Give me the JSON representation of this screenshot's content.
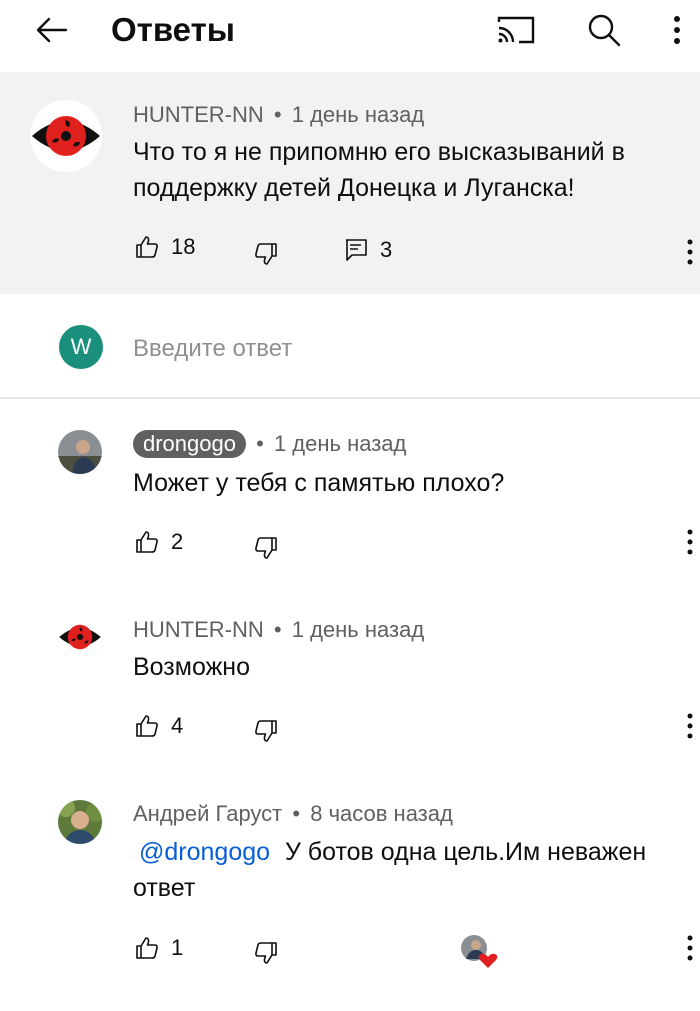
{
  "header": {
    "title": "Ответы",
    "icons": [
      "back-arrow-icon",
      "cast-icon",
      "search-icon",
      "more-vert-icon"
    ]
  },
  "parent_comment": {
    "author": "HUNTER-NN",
    "separator": "•",
    "time": "1 день назад",
    "text": "Что то я не припомню его высказываний в поддержку детей Донецка и Луганска!",
    "likes": "18",
    "replies": "3"
  },
  "reply_box": {
    "avatar_letter": "W",
    "avatar_color": "#1a8f7b",
    "placeholder": "Введите ответ"
  },
  "replies": [
    {
      "author": "drongogo",
      "author_highlighted": true,
      "separator": "•",
      "time": "1 день назад",
      "text": "Может у тебя с памятью плохо?",
      "likes": "2"
    },
    {
      "author": "HUNTER-NN",
      "separator": "•",
      "time": "1 день назад",
      "text": "Возможно",
      "likes": "4"
    },
    {
      "author": "Андрей Гаруст",
      "separator": "•",
      "time": "8 часов назад",
      "mention": "@drongogo",
      "text_after_mention": "У ботов одна цель.Им неважен ответ",
      "likes": "1",
      "creator_hearted": true
    }
  ],
  "colors": {
    "header_bg": "#ffffff",
    "parent_bg": "#f2f2f2",
    "meta_text": "#606060",
    "mention": "#065fd4",
    "heart": "#e02020",
    "chip_bg": "#606060"
  }
}
